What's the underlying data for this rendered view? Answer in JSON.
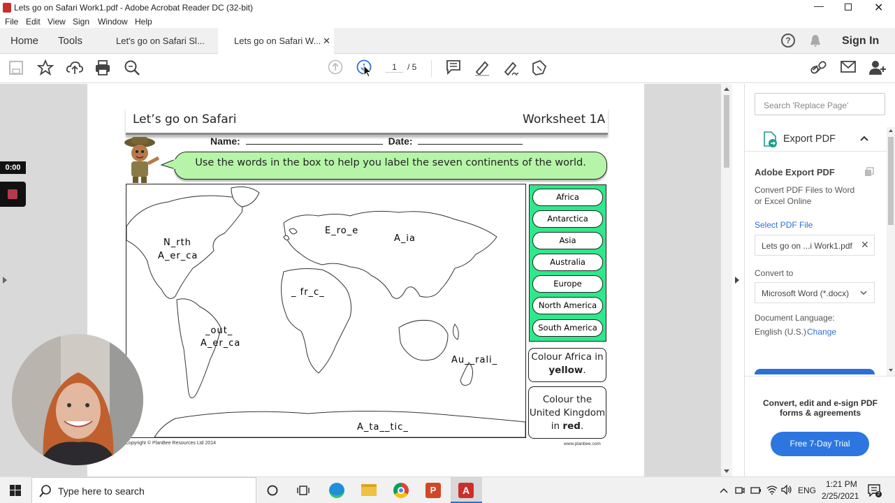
{
  "window": {
    "title": "Lets go on Safari Work1.pdf - Adobe Acrobat Reader DC (32-bit)"
  },
  "menu": [
    "File",
    "Edit",
    "View",
    "Sign",
    "Window",
    "Help"
  ],
  "tabs": {
    "home": "Home",
    "tools": "Tools",
    "doc1": "Let's go on Safari Sl...",
    "doc2": "Lets go on Safari W...",
    "signin": "Sign In"
  },
  "toolbar": {
    "page_current": "1",
    "page_total": "/ 5"
  },
  "worksheet": {
    "title": "Let’s go on Safari",
    "code": "Worksheet 1A",
    "name_label": "Name:",
    "date_label": "Date:",
    "instruction": "Use the words in the box to help you label the seven continents of the world.",
    "words": [
      "Africa",
      "Antarctica",
      "Asia",
      "Australia",
      "Europe",
      "North America",
      "South America"
    ],
    "labels": {
      "north1": "N_rth",
      "north2": "A_er_ca",
      "europe": "E_ro_e",
      "asia": "A_ia",
      "africa": "_ fr_c_",
      "south1": "_out_",
      "south2": "A_er_ca",
      "australia": "Au__rali_",
      "antarctica": "A_ta__tic_"
    },
    "task1a": "Colour Africa in",
    "task1b": "yellow",
    "task2a": "Colour the",
    "task2b": "United Kingdom",
    "task2c": "in",
    "task2d": "red",
    "copyright": "Copyright © PlanBee Resources Ltd 2014",
    "website": "www.planbee.com"
  },
  "video": {
    "timer": "0:00"
  },
  "rightpane": {
    "search_placeholder": "Search 'Replace Page'",
    "export_title": "Export PDF",
    "adobe_export": "Adobe Export PDF",
    "desc1": "Convert PDF Files to Word",
    "desc2": "or Excel Online",
    "select_label": "Select PDF File",
    "file": "Lets go on ...i Work1.pdf",
    "convert_label": "Convert to",
    "convert_value": "Microsoft Word (*.docx)",
    "lang_label": "Document Language:",
    "lang_value": "English (U.S.)",
    "lang_change": "Change",
    "promo1": "Convert, edit and e-sign PDF",
    "promo2": "forms & agreements",
    "trial": "Free 7-Day Trial"
  },
  "taskbar": {
    "search": "Type here to search",
    "lang": "ENG",
    "time": "1:21 PM",
    "date": "2/25/2021"
  }
}
